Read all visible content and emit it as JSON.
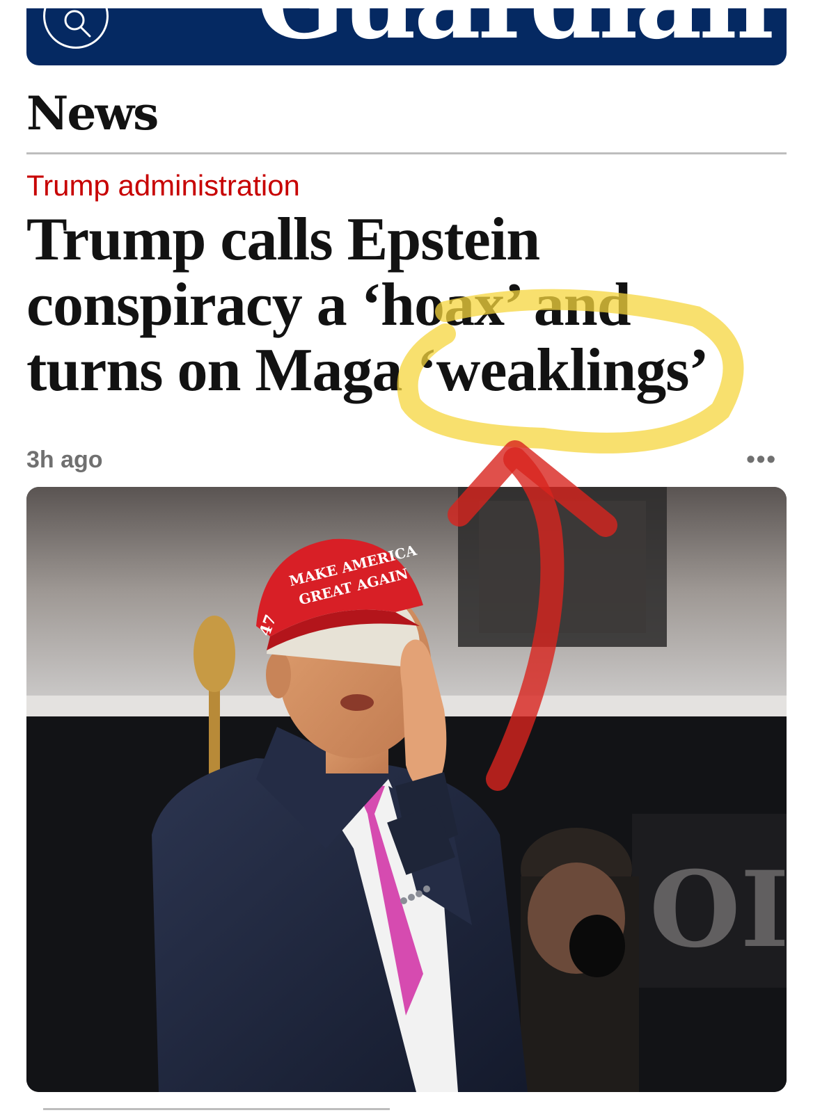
{
  "masthead": {
    "logo_text": "Guardian",
    "background_color": "#052962",
    "search_icon": "search-icon"
  },
  "section": {
    "title": "News"
  },
  "article": {
    "kicker": "Trump administration",
    "kicker_color": "#c70000",
    "headline": "Trump calls Epstein conspiracy a ‘hoax’ and turns on Maga ‘weaklings’",
    "timestamp": "3h ago",
    "more_icon": "more-options-icon",
    "more_label": "•••"
  },
  "photo": {
    "cap_line_1": "MAKE AMERICA",
    "cap_line_2": "GREAT AGAIN",
    "cap_side": "47",
    "background_sign": "OI"
  },
  "annotations": {
    "highlight_color": "#f5d63d",
    "arrow_color": "#d8241e"
  }
}
